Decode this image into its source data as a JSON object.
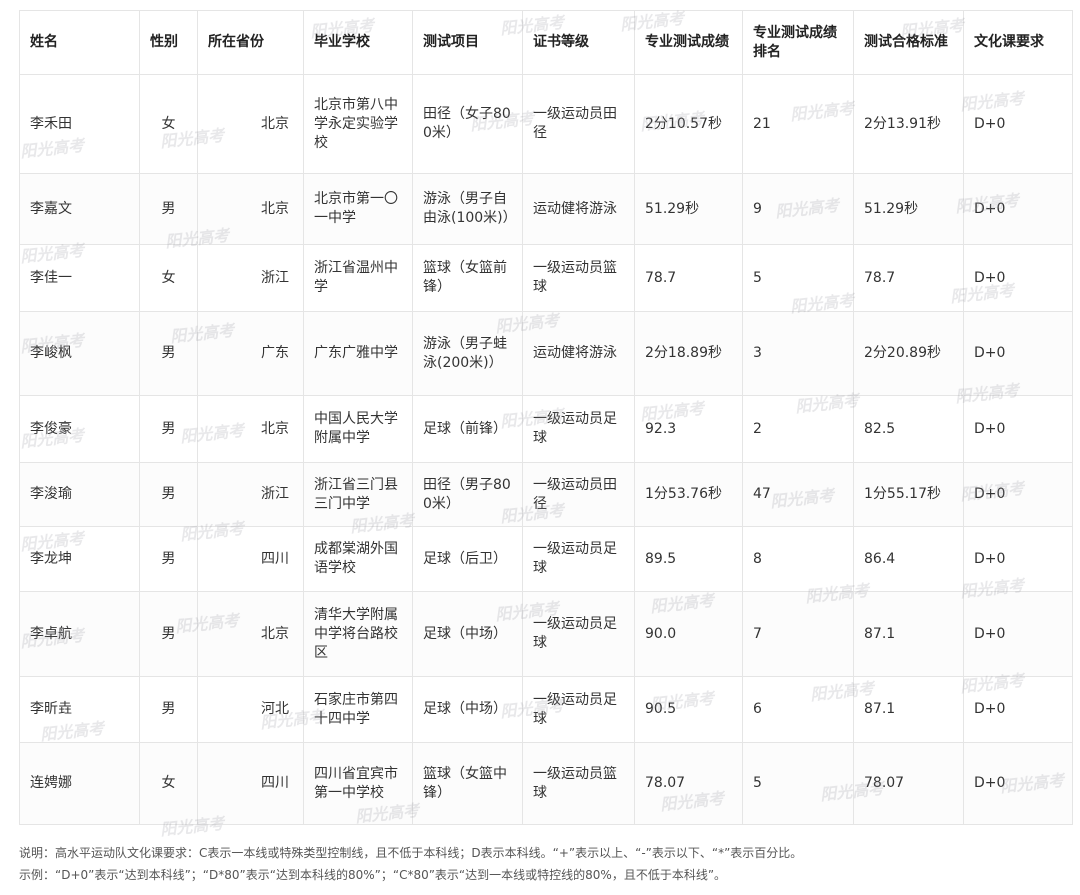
{
  "table": {
    "headers": [
      "姓名",
      "性别",
      "所在省份",
      "毕业学校",
      "测试项目",
      "证书等级",
      "专业测试成绩",
      "专业测试成绩排名",
      "测试合格标准",
      "文化课要求"
    ],
    "rows": [
      [
        "李禾田",
        "女",
        "北京",
        "北京市第八中学永定实验学校",
        "田径（女子800米）",
        "一级运动员田径",
        "2分10.57秒",
        "21",
        "2分13.91秒",
        "D+0"
      ],
      [
        "李嘉文",
        "男",
        "北京",
        "北京市第一〇一中学",
        "游泳（男子自由泳(100米)）",
        "运动健将游泳",
        "51.29秒",
        "9",
        "51.29秒",
        "D+0"
      ],
      [
        "李佳一",
        "女",
        "浙江",
        "浙江省温州中学",
        "篮球（女篮前锋）",
        "一级运动员篮球",
        "78.7",
        "5",
        "78.7",
        "D+0"
      ],
      [
        "李峻枫",
        "男",
        "广东",
        "广东广雅中学",
        "游泳（男子蛙泳(200米)）",
        "运动健将游泳",
        "2分18.89秒",
        "3",
        "2分20.89秒",
        "D+0"
      ],
      [
        "李俊豪",
        "男",
        "北京",
        "中国人民大学附属中学",
        "足球（前锋）",
        "一级运动员足球",
        "92.3",
        "2",
        "82.5",
        "D+0"
      ],
      [
        "李浚瑜",
        "男",
        "浙江",
        "浙江省三门县三门中学",
        "田径（男子800米）",
        "一级运动员田径",
        "1分53.76秒",
        "47",
        "1分55.17秒",
        "D+0"
      ],
      [
        "李龙坤",
        "男",
        "四川",
        "成都棠湖外国语学校",
        "足球（后卫）",
        "一级运动员足球",
        "89.5",
        "8",
        "86.4",
        "D+0"
      ],
      [
        "李卓航",
        "男",
        "北京",
        "清华大学附属中学将台路校区",
        "足球（中场）",
        "一级运动员足球",
        "90.0",
        "7",
        "87.1",
        "D+0"
      ],
      [
        "李昕垚",
        "男",
        "河北",
        "石家庄市第四十四中学",
        "足球（中场）",
        "一级运动员足球",
        "90.5",
        "6",
        "87.1",
        "D+0"
      ],
      [
        "连娉娜",
        "女",
        "四川",
        "四川省宜宾市第一中学校",
        "篮球（女篮中锋）",
        "一级运动员篮球",
        "78.07",
        "5",
        "78.07",
        "D+0"
      ]
    ]
  },
  "notes": {
    "line1": "说明：高水平运动队文化课要求：C表示一本线或特殊类型控制线，且不低于本科线；D表示本科线。“+”表示以上、“-”表示以下、“*”表示百分比。",
    "line2": "示例：“D+0”表示“达到本科线”；“D*80”表示“达到本科线的80%”；“C*80”表示“达到一本线或特控线的80%，且不低于本科线”。"
  },
  "watermark": "阳光高考"
}
